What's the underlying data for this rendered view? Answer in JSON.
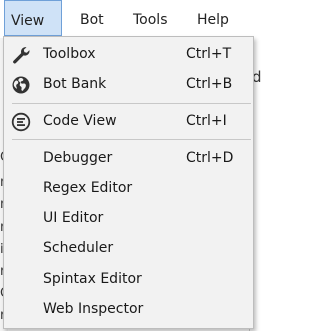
{
  "menubar": {
    "items": [
      {
        "label": "View"
      },
      {
        "label": "Bot"
      },
      {
        "label": "Tools"
      },
      {
        "label": "Help"
      }
    ]
  },
  "background": {
    "left_letters": [
      "C",
      "m",
      "m",
      "n",
      "i",
      "r",
      "C",
      "r"
    ],
    "right_text": "d"
  },
  "menu": {
    "items": [
      {
        "label": "Toolbox",
        "shortcut": "Ctrl+T",
        "icon": "wrench-icon"
      },
      {
        "label": "Bot Bank",
        "shortcut": "Ctrl+B",
        "icon": "globe-icon"
      },
      {
        "label": "Code View",
        "shortcut": "Ctrl+I",
        "icon": "code-view-icon"
      },
      {
        "label": "Debugger",
        "shortcut": "Ctrl+D",
        "icon": ""
      },
      {
        "label": "Regex Editor",
        "shortcut": "",
        "icon": ""
      },
      {
        "label": "UI Editor",
        "shortcut": "",
        "icon": ""
      },
      {
        "label": "Scheduler",
        "shortcut": "",
        "icon": ""
      },
      {
        "label": "Spintax Editor",
        "shortcut": "",
        "icon": ""
      },
      {
        "label": "Web Inspector",
        "shortcut": "",
        "icon": ""
      }
    ]
  },
  "colors": {
    "menubar_active_bg": "#cfe2f7",
    "menubar_active_border": "#6fa0d8",
    "menu_bg": "#f2f2f2"
  }
}
